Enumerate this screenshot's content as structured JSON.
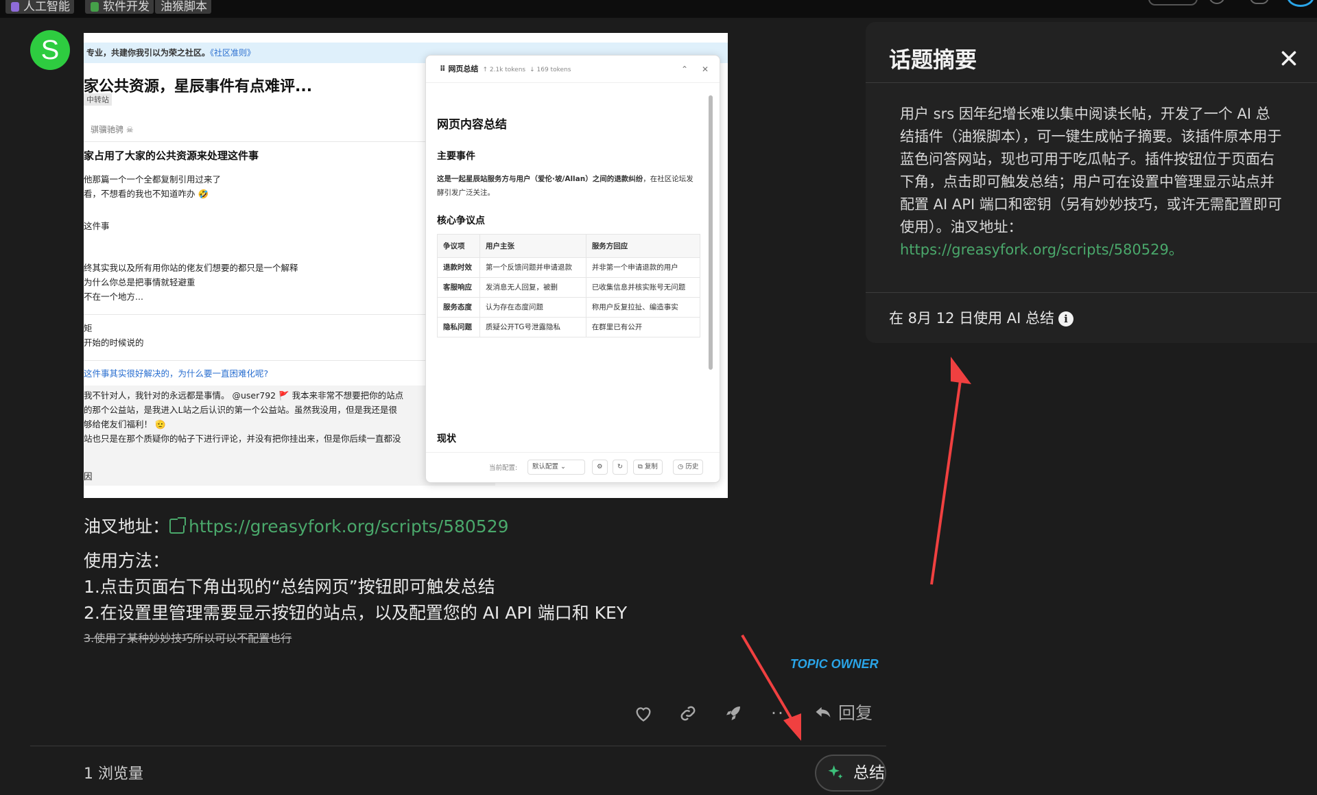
{
  "top_tags": [
    {
      "label": "人工智能",
      "color": "#8e6bd8"
    },
    {
      "label": "软件开发",
      "color": "#45a049"
    },
    {
      "label": "油猴脚本",
      "color": ""
    }
  ],
  "post": {
    "avatar_letter": "S",
    "avatar_color": "#2ecc40",
    "embedded_screenshot": {
      "banner": "专业，共建你我引以为荣之社区。",
      "banner_link": "《社区准则》",
      "title": "家公共资源，星辰事件有点难评...",
      "badge": "中转站",
      "author": "骐骥驰骋",
      "heading2": "家占用了大家的公共资源来处理这件事",
      "lines1": [
        "他那篇一个一个全都复制引用过来了",
        "看，不想看的我也不知道咋办 🤣"
      ],
      "line2": "这件事",
      "lines3": [
        "终其实我以及所有用你站的佬友们想要的都只是一个解释",
        "为什么你总是把事情就轻避重",
        "不在一个地方..."
      ],
      "lines4": [
        "矩",
        "开始的时候说的"
      ],
      "question": "这件事其实很好解决的，为什么要一直困难化呢?",
      "lines5": [
        "我不针对人，我针对的永远都是事情。 @user792 🚩 我本来非常不想要把你的站点",
        "的那个公益站，是我进入L站之后认识的第一个公益站。虽然我没用，但是我还是很",
        "够给佬友们福利！ 🫡",
        "站也只是在那个质疑你的帖子下进行评论，并没有把你挂出来，但是你后续一直都没"
      ],
      "line6": "因",
      "panel": {
        "title": "网页总结",
        "tokens_up": "↑ 2.1k tokens",
        "tokens_down": "↓ 169 tokens",
        "h1": "网页内容总结",
        "h_main": "主要事件",
        "main_text_bold": "这是一起星辰站服务方与用户（爱伦·坡/Allan）之间的退款纠纷",
        "main_text_rest": "，在社区论坛发酵引发广泛关注。",
        "h_core": "核心争议点",
        "table_headers": [
          "争议项",
          "用户主张",
          "服务方回应"
        ],
        "table_rows": [
          [
            "退款时效",
            "第一个反馈问题并申请退款",
            "并非第一个申请退款的用户"
          ],
          [
            "客服响应",
            "发消息无人回复，被删",
            "已收集信息并核实账号无问题"
          ],
          [
            "服务态度",
            "认为存在态度问题",
            "称用户反复拉扯、编造事实"
          ],
          [
            "隐私问题",
            "质疑公开TG号泄露隐私",
            "在群里已有公开"
          ]
        ],
        "h_status": "现状",
        "footer_label": "当前配置:",
        "footer_select": "默认配置",
        "btn_copy": "复制",
        "btn_history": "历史"
      }
    },
    "script_label": "油叉地址：",
    "script_url": "https://greasyfork.org/scripts/580529",
    "usage_title": "使用方法：",
    "usage_1": "1.点击页面右下角出现的“总结网页”按钮即可触发总结",
    "usage_2": "2.在设置里管理需要显示按钮的站点，以及配置您的 AI API 端口和 KEY",
    "usage_3_strike": "3.使用了某种妙妙技巧所以可以不配置也行",
    "owner_badge": "TOPIC OWNER",
    "reply_label": "回复",
    "views": "1 浏览量",
    "summarize_label": "总结"
  },
  "summary_popover": {
    "title": "话题摘要",
    "body": "用户 srs 因年纪增长难以集中阅读长帖，开发了一个 AI 总结插件（油猴脚本），可一键生成帖子摘要。该插件原本用于蓝色问答网站，现也可用于吃瓜帖子。插件按钮位于页面右下角，点击即可触发总结；用户可在设置中管理显示站点并配置 AI API 端口和密钥（另有妙妙技巧，或许无需配置即可使用）。油叉地址：",
    "link": "https://greasyfork.org/scripts/580529",
    "link_suffix": "。",
    "footer": "在 8月 12 日使用 AI 总结"
  },
  "colors": {
    "accent_green": "#4aa86b",
    "owner_blue": "#2aa5e8",
    "arrow_red": "#f04040"
  }
}
